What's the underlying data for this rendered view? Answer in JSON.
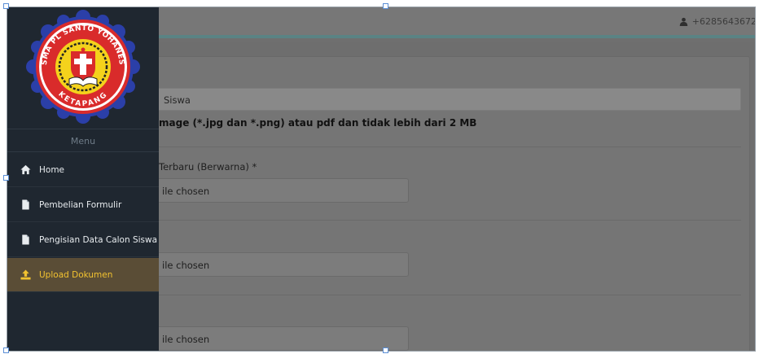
{
  "navbar": {
    "user_text": "+6285643672"
  },
  "sidebar": {
    "logo_text_top": "SMA PL SANTO YOHANES",
    "logo_text_bottom": "KETAPANG",
    "menu_header": "Menu",
    "items": [
      {
        "label": "Home",
        "icon": "home-icon",
        "active": false
      },
      {
        "label": "Pembelian Formulir",
        "icon": "file-icon",
        "active": false
      },
      {
        "label": "Pengisian Data Calon Siswa",
        "icon": "file-icon",
        "active": false
      },
      {
        "label": "Upload Dokumen",
        "icon": "upload-icon",
        "active": true
      }
    ]
  },
  "main": {
    "card_title": "Siswa",
    "note": "mage (*.jpg dan *.png) atau pdf dan tidak lebih dari 2 MB",
    "fields": [
      {
        "label": "Terbaru (Berwarna) *",
        "file_text": "ile chosen"
      },
      {
        "label": "",
        "file_text": "ile chosen"
      },
      {
        "label": "",
        "file_text": "ile chosen"
      }
    ]
  },
  "colors": {
    "sidebar_bg": "#1f2730",
    "active_bg": "#5a4d36",
    "active_text": "#f2c230",
    "navbar_accent": "#5a8384"
  }
}
